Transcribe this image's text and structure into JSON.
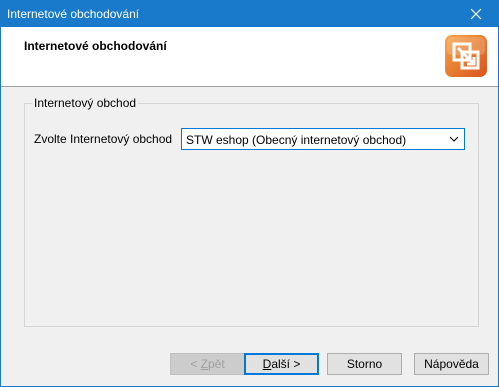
{
  "window": {
    "title": "Internetové obchodování"
  },
  "header": {
    "title": "Internetové obchodování",
    "logo_icon": "wizard-logo-icon"
  },
  "group": {
    "legend": "Internetový obchod",
    "shop_label": "Zvolte Internetový obchod",
    "shop_select": {
      "value": "STW eshop (Obecný internetový obchod)"
    }
  },
  "buttons": {
    "back": {
      "prefix": "< ",
      "mnemonic": "Z",
      "rest": "pět"
    },
    "next": {
      "mnemonic": "D",
      "rest": "alší >"
    },
    "cancel": "Storno",
    "help": "Nápověda"
  },
  "colors": {
    "titlebar": "#1979ca",
    "accent": "#0078d7",
    "logo_orange": "#e8742a"
  }
}
